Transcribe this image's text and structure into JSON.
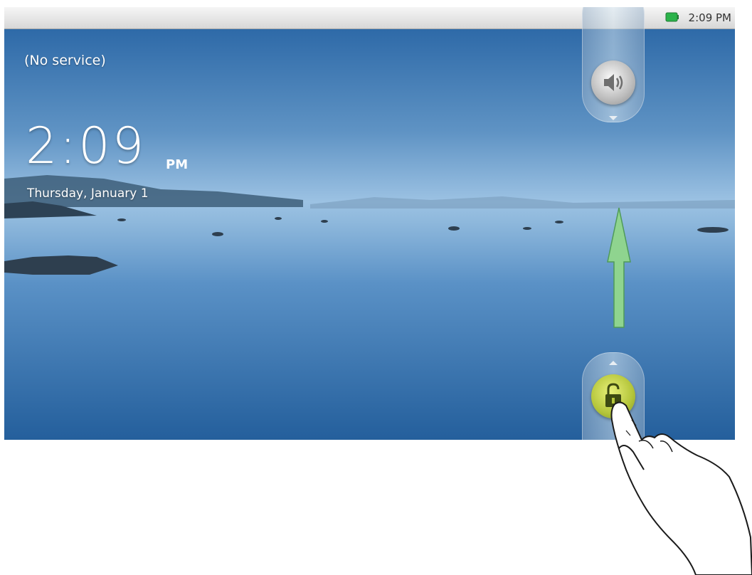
{
  "status_bar": {
    "time": "2:09 PM",
    "battery_icon": "battery-icon",
    "battery_color": "#2bb34a"
  },
  "lock_screen": {
    "carrier": "(No service)",
    "clock": {
      "time": "2:09",
      "ampm": "PM"
    },
    "date": "Thursday, January 1",
    "sound_tab": {
      "icon": "speaker-icon"
    },
    "unlock_tab": {
      "icon": "unlock-icon",
      "color": "#b4c53a"
    }
  },
  "overlay": {
    "arrow_color": "#8fd48f",
    "hand_icon": "pointing-hand-icon"
  }
}
